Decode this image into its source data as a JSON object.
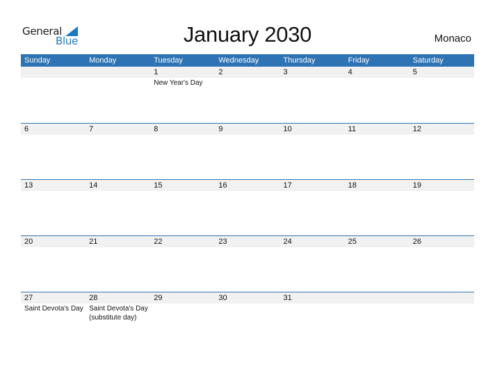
{
  "logo": {
    "word1": "General",
    "word2": "Blue"
  },
  "title": "January 2030",
  "country": "Monaco",
  "colors": {
    "header_bg": "#2e73b4",
    "date_strip_bg": "#f1f1f1",
    "brand_blue": "#1b78c4"
  },
  "weekdays": [
    "Sunday",
    "Monday",
    "Tuesday",
    "Wednesday",
    "Thursday",
    "Friday",
    "Saturday"
  ],
  "weeks": [
    {
      "days": [
        "",
        "",
        "1",
        "2",
        "3",
        "4",
        "5"
      ],
      "holidays": [
        "",
        "",
        "New Year's Day",
        "",
        "",
        "",
        ""
      ]
    },
    {
      "days": [
        "6",
        "7",
        "8",
        "9",
        "10",
        "11",
        "12"
      ],
      "holidays": [
        "",
        "",
        "",
        "",
        "",
        "",
        ""
      ]
    },
    {
      "days": [
        "13",
        "14",
        "15",
        "16",
        "17",
        "18",
        "19"
      ],
      "holidays": [
        "",
        "",
        "",
        "",
        "",
        "",
        ""
      ]
    },
    {
      "days": [
        "20",
        "21",
        "22",
        "23",
        "24",
        "25",
        "26"
      ],
      "holidays": [
        "",
        "",
        "",
        "",
        "",
        "",
        ""
      ]
    },
    {
      "days": [
        "27",
        "28",
        "29",
        "30",
        "31",
        "",
        ""
      ],
      "holidays": [
        "Saint Devota's Day",
        "Saint Devota's Day\n(substitute day)",
        "",
        "",
        "",
        "",
        ""
      ]
    }
  ]
}
